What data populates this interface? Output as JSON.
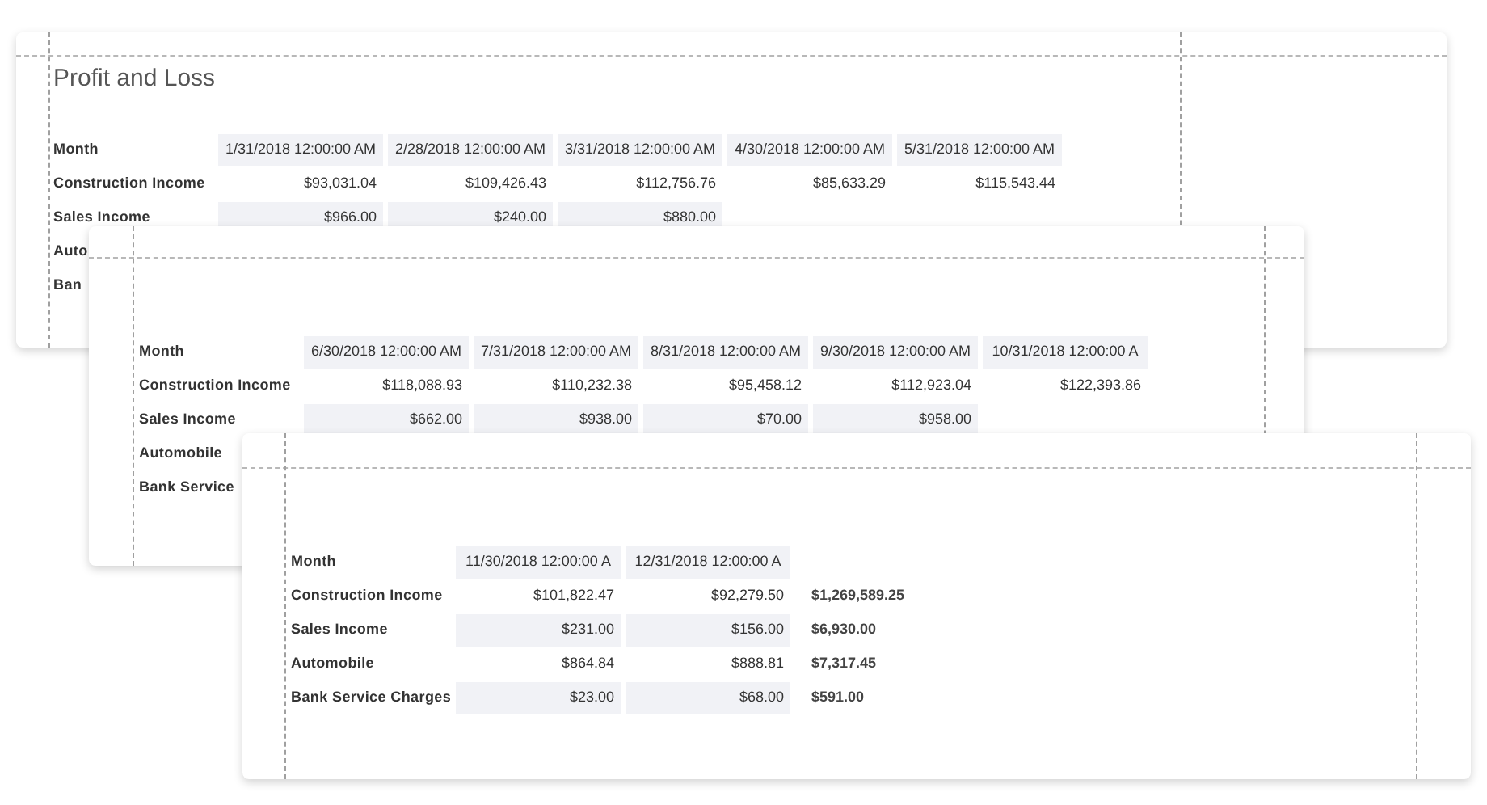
{
  "pages": [
    {
      "title": "Profit and Loss",
      "header_label": "Month",
      "columns": [
        "1/31/2018 12:00:00 AM",
        "2/28/2018 12:00:00 AM",
        "3/31/2018 12:00:00 AM",
        "4/30/2018 12:00:00 AM",
        "5/31/2018 12:00:00 AM"
      ],
      "rows": [
        {
          "label": "Construction Income",
          "values": [
            "$93,031.04",
            "$109,426.43",
            "$112,756.76",
            "$85,633.29",
            "$115,543.44"
          ]
        },
        {
          "label": "Sales Income",
          "values": [
            "$966.00",
            "$240.00",
            "$880.00"
          ]
        },
        {
          "label": "Auto",
          "values": []
        },
        {
          "label": "Ban",
          "values": []
        }
      ]
    },
    {
      "header_label": "Month",
      "columns": [
        "6/30/2018 12:00:00 AM",
        "7/31/2018 12:00:00 AM",
        "8/31/2018 12:00:00 AM",
        "9/30/2018 12:00:00 AM",
        "10/31/2018 12:00:00 A"
      ],
      "rows": [
        {
          "label": "Construction Income",
          "values": [
            "$118,088.93",
            "$110,232.38",
            "$95,458.12",
            "$112,923.04",
            "$122,393.86"
          ]
        },
        {
          "label": "Sales Income",
          "values": [
            "$662.00",
            "$938.00",
            "$70.00",
            "$958.00"
          ]
        },
        {
          "label": "Automobile",
          "values": []
        },
        {
          "label": "Bank Service",
          "values": []
        }
      ]
    },
    {
      "header_label": "Month",
      "columns": [
        "11/30/2018 12:00:00 A",
        "12/31/2018 12:00:00 A"
      ],
      "rows": [
        {
          "label": "Construction Income",
          "values": [
            "$101,822.47",
            "$92,279.50"
          ],
          "total": "$1,269,589.25"
        },
        {
          "label": "Sales Income",
          "values": [
            "$231.00",
            "$156.00"
          ],
          "total": "$6,930.00"
        },
        {
          "label": "Automobile",
          "values": [
            "$864.84",
            "$888.81"
          ],
          "total": "$7,317.45"
        },
        {
          "label": "Bank Service Charges",
          "values": [
            "$23.00",
            "$68.00"
          ],
          "total": "$591.00"
        }
      ]
    }
  ]
}
